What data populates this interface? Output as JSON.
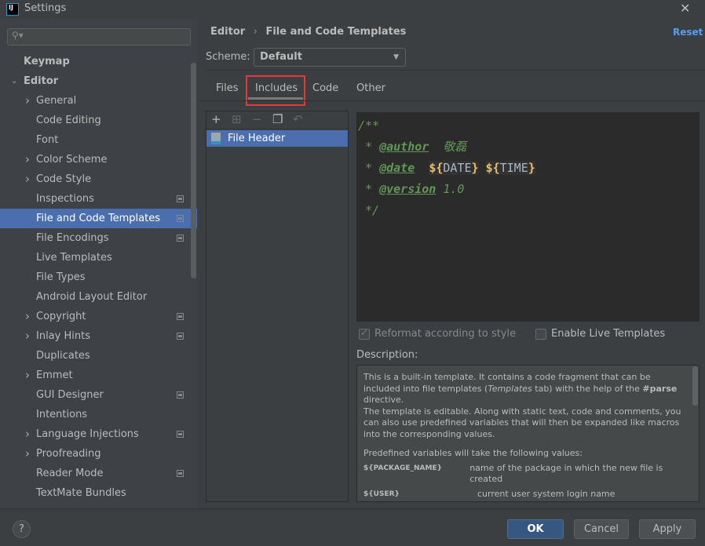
{
  "window": {
    "title": "Settings",
    "app_icon": "IJ",
    "close_icon": "✕"
  },
  "search": {
    "placeholder": "",
    "icon": "search-icon"
  },
  "sidebar": {
    "items": [
      {
        "label": "Keymap",
        "bold": true
      },
      {
        "label": "Editor",
        "bold": true,
        "expanded": true
      },
      {
        "label": "General",
        "arrow": true
      },
      {
        "label": "Code Editing"
      },
      {
        "label": "Font"
      },
      {
        "label": "Color Scheme",
        "arrow": true
      },
      {
        "label": "Code Style",
        "arrow": true
      },
      {
        "label": "Inspections",
        "badge": true
      },
      {
        "label": "File and Code Templates",
        "selected": true,
        "badge": true
      },
      {
        "label": "File Encodings",
        "badge": true
      },
      {
        "label": "Live Templates"
      },
      {
        "label": "File Types"
      },
      {
        "label": "Android Layout Editor"
      },
      {
        "label": "Copyright",
        "arrow": true,
        "badge": true
      },
      {
        "label": "Inlay Hints",
        "arrow": true,
        "badge": true
      },
      {
        "label": "Duplicates"
      },
      {
        "label": "Emmet",
        "arrow": true
      },
      {
        "label": "GUI Designer",
        "badge": true
      },
      {
        "label": "Intentions"
      },
      {
        "label": "Language Injections",
        "arrow": true,
        "badge": true
      },
      {
        "label": "Proofreading",
        "arrow": true
      },
      {
        "label": "Reader Mode",
        "badge": true
      },
      {
        "label": "TextMate Bundles"
      }
    ]
  },
  "header": {
    "breadcrumb_parent": "Editor",
    "breadcrumb_sep": "›",
    "breadcrumb_current": "File and Code Templates",
    "reset": "Reset"
  },
  "scheme": {
    "label": "Scheme:",
    "value": "Default"
  },
  "tabs": [
    {
      "label": "Files"
    },
    {
      "label": "Includes",
      "active": true
    },
    {
      "label": "Code"
    },
    {
      "label": "Other"
    }
  ],
  "toolbar": {
    "add": "+",
    "add_child": "⊞",
    "remove": "−",
    "copy": "❐",
    "reset": "↶"
  },
  "templates": [
    {
      "label": "File Header",
      "selected": true
    }
  ],
  "editor": {
    "line1": "/**",
    "author_prefix": " * ",
    "author_tag": "@author",
    "author_value": "  敬磊",
    "date_prefix": " * ",
    "date_tag": "@date",
    "date_var1": "DATE",
    "date_var2": "TIME",
    "version_prefix": " * ",
    "version_tag": "@version",
    "version_value": " 1.0",
    "end": " */"
  },
  "options": {
    "reformat": {
      "label": "Reformat according to style",
      "checked": true,
      "disabled": true
    },
    "live_templates": {
      "label": "Enable Live Templates",
      "checked": false
    }
  },
  "description": {
    "label": "Description:",
    "p1a": "This is a built-in template. It contains a code fragment that can be included into file templates (",
    "p1em": "Templates",
    "p1b": " tab) with the help of the ",
    "p1strong": "#parse",
    "p1c": " directive.",
    "p2": "The template is editable. Along with static text, code and comments, you can also use predefined variables that will then be expanded like macros into the corresponding values.",
    "p3": "Predefined variables will take the following values:",
    "vars": [
      {
        "name": "${PACKAGE_NAME}",
        "desc": "name of the package in which the new file is created"
      },
      {
        "name": "${USER}",
        "desc": "current user system login name"
      }
    ]
  },
  "footer": {
    "help": "?",
    "ok": "OK",
    "cancel": "Cancel",
    "apply": "Apply"
  },
  "colors": {
    "accent": "#4b6eaf",
    "ok_button": "#365880",
    "highlight_box": "#e53935",
    "comment": "#629755",
    "template_var": "#e8bf6a",
    "link": "#589df6"
  }
}
